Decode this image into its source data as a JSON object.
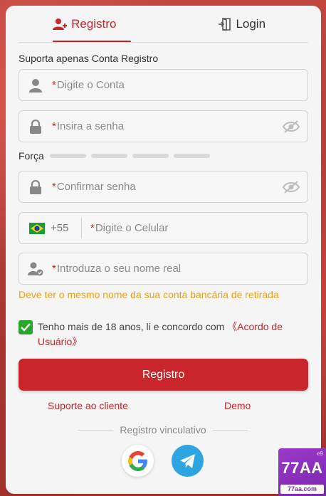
{
  "tabs": [
    {
      "label": "Registro",
      "active": true,
      "icon": "user-plus-icon"
    },
    {
      "label": "Login",
      "active": false,
      "icon": "door-enter-icon"
    }
  ],
  "form": {
    "hint": "Suporta apenas Conta Registro",
    "account": {
      "required_mark": "*",
      "placeholder": "Digite o Conta",
      "icon": "user-icon"
    },
    "password": {
      "required_mark": "*",
      "placeholder": "Insira a senha",
      "icon": "lock-icon"
    },
    "strength_label": "Força",
    "confirm": {
      "required_mark": "*",
      "placeholder": "Confirmar senha",
      "icon": "lock-icon"
    },
    "phone": {
      "country_code": "+55",
      "flag": "brazil-flag-icon",
      "required_mark": "*",
      "placeholder": "Digite o Celular"
    },
    "real_name": {
      "required_mark": "*",
      "placeholder": "Introduza o seu nome real",
      "icon": "user-check-icon"
    },
    "name_warning": "Deve ter o mesmo nome da sua conta bancária de retirada",
    "agreement": {
      "text": "Tenho mais de 18 anos, li e concordo com ",
      "link": "《Acordo de Usuário》",
      "checked": true
    },
    "submit_label": "Registro"
  },
  "footer": {
    "support_link": "Suporte ao cliente",
    "demo_link": "Demo",
    "bind_label": "Registro vinculativo"
  },
  "brand": {
    "name": "77AA",
    "url": "77aa.com",
    "small": "e9"
  },
  "colors": {
    "accent": "#c8262b",
    "warning": "#e8a21c",
    "check": "#2aa52a",
    "telegram": "#2ca5e0"
  }
}
